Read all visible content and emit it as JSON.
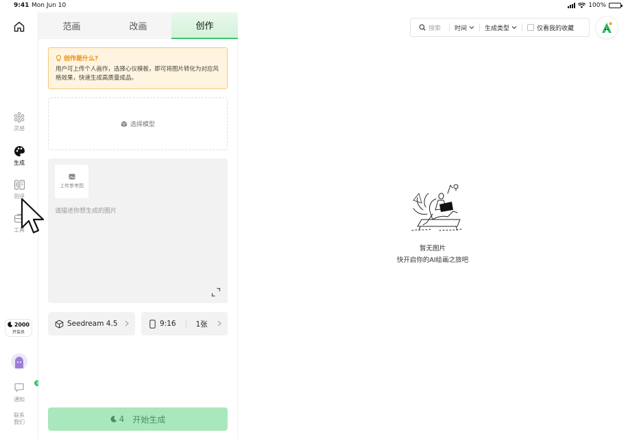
{
  "status_bar": {
    "time": "9:41",
    "date": "Mon Jun 10",
    "battery": "100%"
  },
  "rail": {
    "items": [
      {
        "label": "灵感",
        "icon": "dots-grid-icon"
      },
      {
        "label": "生成",
        "icon": "palette-icon"
      },
      {
        "label": "测评",
        "icon": "clipboard-icon"
      },
      {
        "label": "工具",
        "icon": "toolbox-icon"
      }
    ],
    "active_item": "生成",
    "coins": "2000",
    "coins_sub": "开会员",
    "messages_label": "通知",
    "messages_badge": "1",
    "contact_line1": "联系",
    "contact_line2": "我们"
  },
  "panel": {
    "tabs": [
      {
        "label": "范画"
      },
      {
        "label": "改画"
      },
      {
        "label": "创作"
      }
    ],
    "active_tab": "创作",
    "info": {
      "title": "创作是什么?",
      "desc": "用户可上传个人画作，选择心仪模板，即可将图片转化为对应风格效果，快速生成高质量成品。"
    },
    "model_select_label": "选择模型",
    "upload_label": "上传参考图",
    "prompt_placeholder": "请描述你想生成的图片",
    "model_name": "Seedream 4.5",
    "ratio": "9:16",
    "count": "1张",
    "generate_cost": "4",
    "generate_label": "开始生成"
  },
  "toolbar": {
    "search_placeholder": "搜索",
    "time_filter": "时间",
    "type_filter": "生成类型",
    "favorites_only": "仅看我的收藏"
  },
  "empty_state": {
    "line1": "暂无图片",
    "line2": "快开启你的AI绘画之旅吧"
  },
  "colors": {
    "accent": "#3cc46c",
    "accent_light": "#a9e8bc",
    "info_bg": "#fff4df",
    "info_border": "#f6c77c",
    "info_title": "#e88f12"
  }
}
